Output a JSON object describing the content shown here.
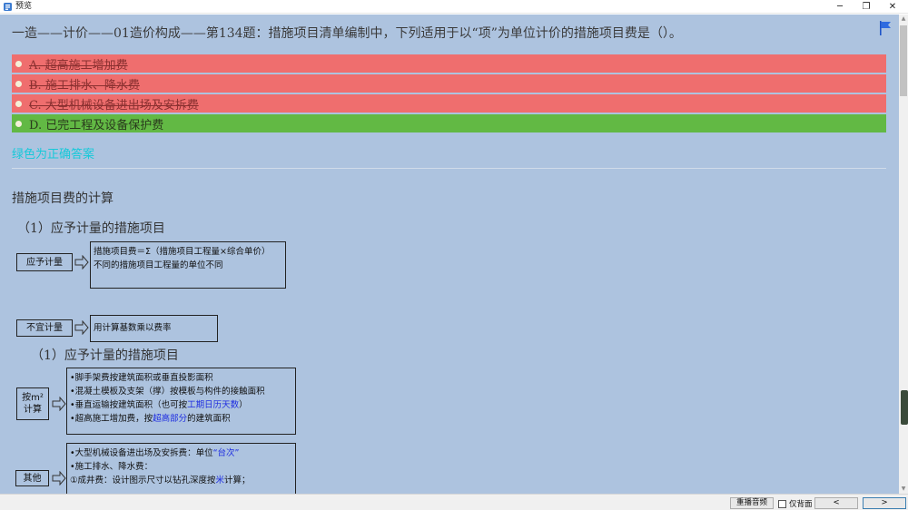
{
  "window": {
    "title": "预览",
    "minimize_glyph": "─",
    "maximize_glyph": "❐",
    "close_glyph": "✕"
  },
  "question": {
    "text": "一造——计价——01造价构成——第134题：措施项目清单编制中，下列适用于以“项”为单位计价的措施项目费是（）。"
  },
  "options": [
    {
      "label": "A. 超高施工增加费",
      "state": "wrong"
    },
    {
      "label": "B. 施工排水、降水费",
      "state": "wrong"
    },
    {
      "label": "C. 大型机械设备进出场及安拆费",
      "state": "wrong"
    },
    {
      "label": "D. 已完工程及设备保护费",
      "state": "correct"
    }
  ],
  "answer_note": "绿色为正确答案",
  "explanation": {
    "section_title": "措施项目费的计算",
    "subtitle_1": "（1）应予计量的措施项目",
    "diagram1": {
      "tag_a": "应予计量",
      "desc_a_line1": "措施项目费＝Σ（措施项目工程量×综合单价）",
      "desc_a_line2": "不同的措施项目工程量的单位不同",
      "tag_b": "不宜计量",
      "desc_b": "用计算基数乘以费率"
    },
    "subtitle_2": "（1）应予计量的措施项目",
    "diagram2": {
      "tag_a_line1": "按m²",
      "tag_a_line2": "计算",
      "items": [
        "•脚手架费按建筑面积或垂直投影面积",
        "•混凝土模板及支架（撑）按模板与构件的接触面积",
        "•垂直运输按建筑面积（也可按",
        "•超高施工增加费，按",
        "的建筑面积"
      ],
      "hl_1": "工期日历天数",
      "hl_1_suffix": "）",
      "hl_2": "超高部分",
      "tag_b": "其他",
      "other_items": [
        "•大型机械设备进出场及安拆费：单位",
        "•施工排水、降水费：",
        "①成井费：设计图示尺寸以钻孔深度按",
        "计算；"
      ],
      "other_hl_1": "“台次”",
      "other_hl_2": "米"
    }
  },
  "bottom": {
    "replay_label": "重播音频",
    "back_only_label": "仅背面",
    "prev_label": "<",
    "next_label": ">"
  },
  "colors": {
    "content_bg": "#adc3df",
    "wrong_option": "#ef6e6e",
    "correct_option": "#62b944",
    "answer_note": "#16c9d9",
    "highlight_text": "#1f2ee0"
  },
  "icons": {
    "flag": "flag-icon",
    "app": "app-icon"
  }
}
